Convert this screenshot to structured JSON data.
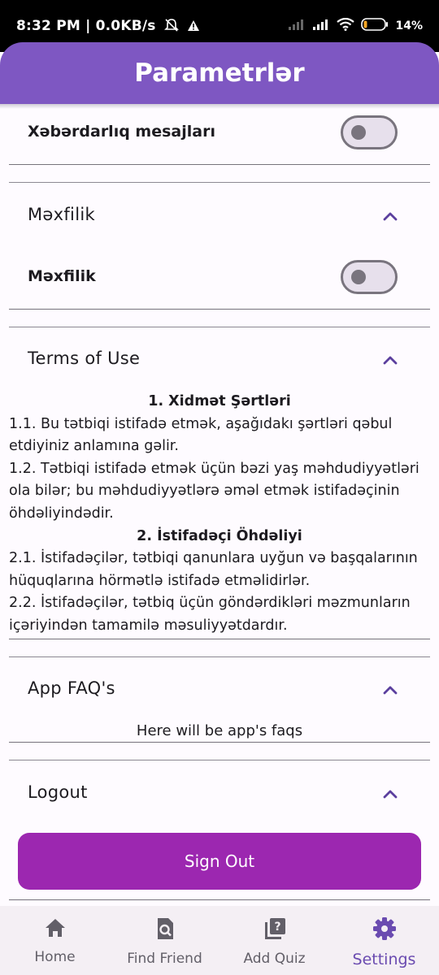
{
  "status": {
    "time": "8:32 PM | 0.0KB/s",
    "battery": "14%"
  },
  "appbar": {
    "title": "Parametrlər"
  },
  "notifications": {
    "label": "Xəbərdarlıq mesajları",
    "enabled": false
  },
  "privacy": {
    "section_title": "Məxfilik",
    "toggle_label": "Məxfilik",
    "enabled": false
  },
  "terms": {
    "section_title": "Terms of Use",
    "heading1": "1. Xidmət Şərtləri",
    "p1": "1.1. Bu tətbiqi istifadə etmək, aşağıdakı şərtləri qəbul etdiyiniz anlamına gəlir.",
    "p2": "1.2. Tətbiqi istifadə etmək üçün bəzi yaş məhdudiyyətləri ola bilər; bu məhdudiyyətlərə əməl etmək istifadəçinin öhdəliyindədir.",
    "heading2": "2. İstifadəçi Öhdəliyi",
    "p3": "2.1. İstifadəçilər, tətbiqi qanunlara uyğun və başqalarının hüquqlarına hörmətlə istifadə etməlidirlər.",
    "p4": "2.2. İstifadəçilər, tətbiq üçün göndərdikləri məzmunların içəriyindən tamamilə məsuliyyətdardır."
  },
  "faq": {
    "section_title": "App FAQ's",
    "body": "Here will be app's faqs"
  },
  "logout": {
    "section_title": "Logout",
    "button_label": "Sign Out"
  },
  "nav": {
    "items": [
      {
        "label": "Home",
        "icon": "home-icon"
      },
      {
        "label": "Find Friend",
        "icon": "find-friend-icon"
      },
      {
        "label": "Add Quiz",
        "icon": "add-quiz-icon"
      },
      {
        "label": "Settings",
        "icon": "settings-icon"
      }
    ],
    "active": "Settings"
  },
  "colors": {
    "appbar": "#7e57c2",
    "signout_button": "#9c27b0",
    "active_nav": "#6a4bb0"
  }
}
